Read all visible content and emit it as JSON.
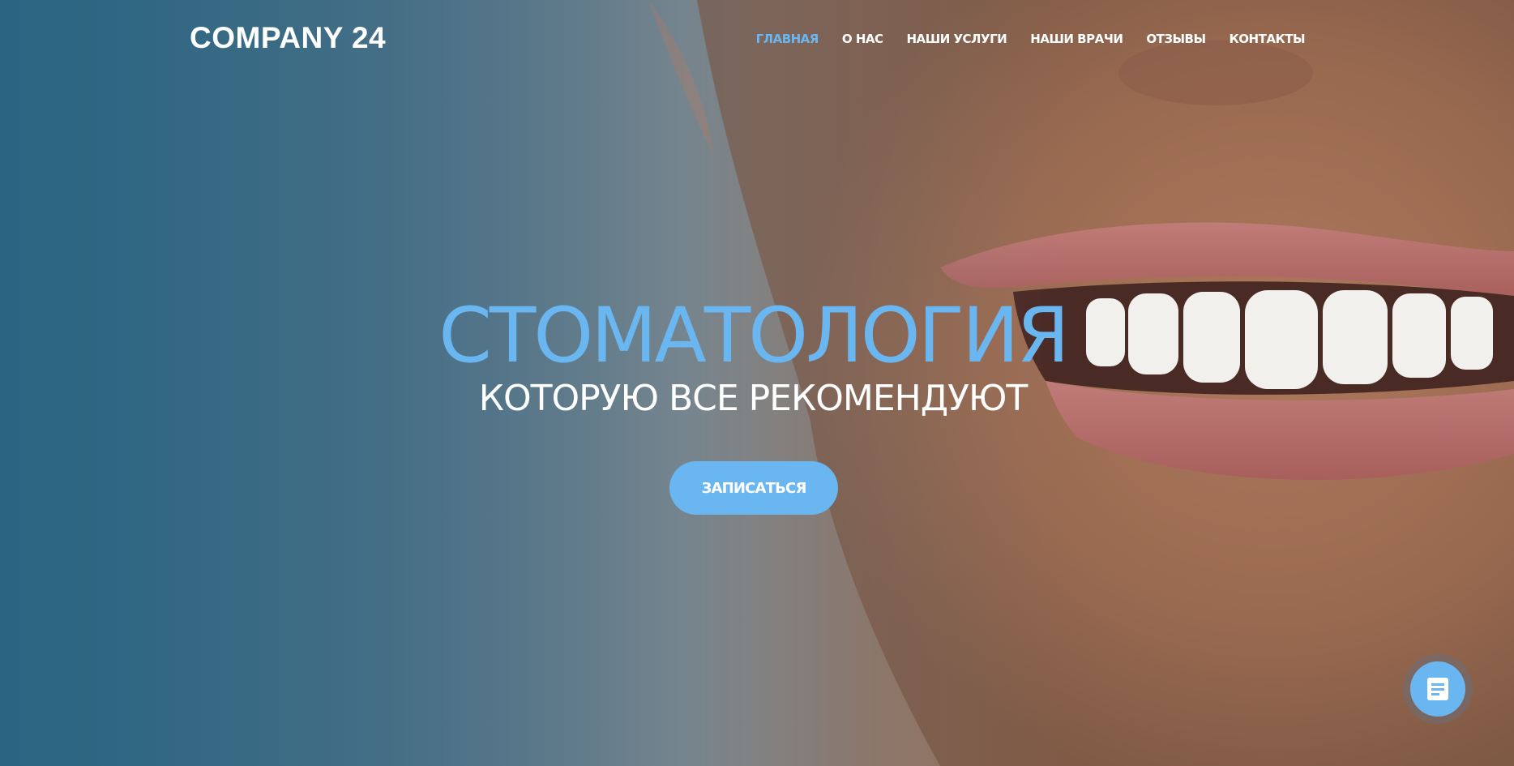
{
  "header": {
    "logo": "COMPANY 24",
    "nav": [
      {
        "label": "ГЛАВНАЯ",
        "active": true
      },
      {
        "label": "О НАС",
        "active": false
      },
      {
        "label": "НАШИ УСЛУГИ",
        "active": false
      },
      {
        "label": "НАШИ ВРАЧИ",
        "active": false
      },
      {
        "label": "ОТЗЫВЫ",
        "active": false
      },
      {
        "label": "КОНТАКТЫ",
        "active": false
      }
    ]
  },
  "hero": {
    "headline": "СТОМАТОЛОГИЯ",
    "subheadline": "КОТОРУЮ ВСЕ РЕКОМЕНДУЮТ",
    "cta_label": "ЗАПИСАТЬСЯ",
    "background_image": "smile-photo"
  },
  "widget": {
    "icon": "form-icon"
  },
  "colors": {
    "accent": "#6ab6f0",
    "text": "#ffffff",
    "overlay": "#2f6680"
  }
}
